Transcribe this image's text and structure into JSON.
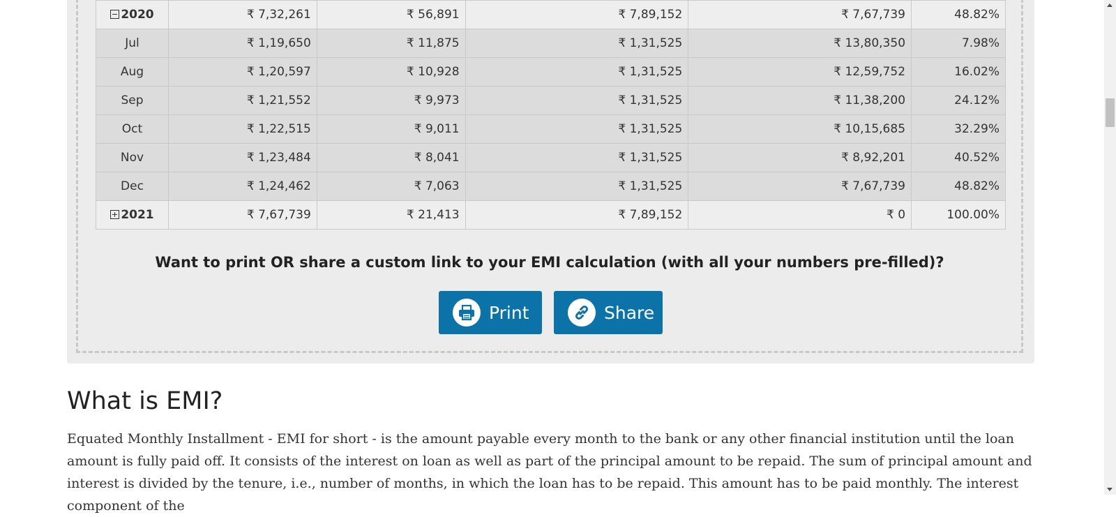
{
  "table": {
    "rows": [
      {
        "type": "year",
        "expanded": true,
        "label": "2020",
        "principal": "₹ 7,32,261",
        "interest": "₹ 56,891",
        "total": "₹ 7,89,152",
        "balance": "₹ 7,67,739",
        "paid_pct": "48.82%"
      },
      {
        "type": "month",
        "label": "Jul",
        "principal": "₹ 1,19,650",
        "interest": "₹ 11,875",
        "total": "₹ 1,31,525",
        "balance": "₹ 13,80,350",
        "paid_pct": "7.98%"
      },
      {
        "type": "month",
        "label": "Aug",
        "principal": "₹ 1,20,597",
        "interest": "₹ 10,928",
        "total": "₹ 1,31,525",
        "balance": "₹ 12,59,752",
        "paid_pct": "16.02%"
      },
      {
        "type": "month",
        "label": "Sep",
        "principal": "₹ 1,21,552",
        "interest": "₹ 9,973",
        "total": "₹ 1,31,525",
        "balance": "₹ 11,38,200",
        "paid_pct": "24.12%"
      },
      {
        "type": "month",
        "label": "Oct",
        "principal": "₹ 1,22,515",
        "interest": "₹ 9,011",
        "total": "₹ 1,31,525",
        "balance": "₹ 10,15,685",
        "paid_pct": "32.29%"
      },
      {
        "type": "month",
        "label": "Nov",
        "principal": "₹ 1,23,484",
        "interest": "₹ 8,041",
        "total": "₹ 1,31,525",
        "balance": "₹ 8,92,201",
        "paid_pct": "40.52%"
      },
      {
        "type": "month",
        "label": "Dec",
        "principal": "₹ 1,24,462",
        "interest": "₹ 7,063",
        "total": "₹ 1,31,525",
        "balance": "₹ 7,67,739",
        "paid_pct": "48.82%"
      },
      {
        "type": "year",
        "expanded": false,
        "label": "2021",
        "principal": "₹ 7,67,739",
        "interest": "₹ 21,413",
        "total": "₹ 7,89,152",
        "balance": "₹ 0",
        "paid_pct": "100.00%"
      }
    ]
  },
  "share_section": {
    "prompt": "Want to print OR share a custom link to your EMI calculation (with all your numbers pre-filled)?",
    "print_label": "Print",
    "share_label": "Share"
  },
  "article": {
    "heading": "What is EMI?",
    "paragraph": "Equated Monthly Installment - EMI for short - is the amount payable every month to the bank or any other financial institution until the loan amount is fully paid off. It consists of the interest on loan as well as part of the principal amount to be repaid. The sum of principal amount and interest is divided by the tenure, i.e., number of months, in which the loan has to be repaid. This amount has to be paid monthly. The interest component of the"
  },
  "colors": {
    "button_bg": "#0b73a8",
    "panel_bg": "#ececec",
    "month_row_bg": "#dcdcdc",
    "year_row_bg": "#eeeeee"
  },
  "icons": {
    "print": "printer-icon",
    "share": "link-icon",
    "collapse": "minus-square-icon",
    "expand": "plus-square-icon"
  }
}
